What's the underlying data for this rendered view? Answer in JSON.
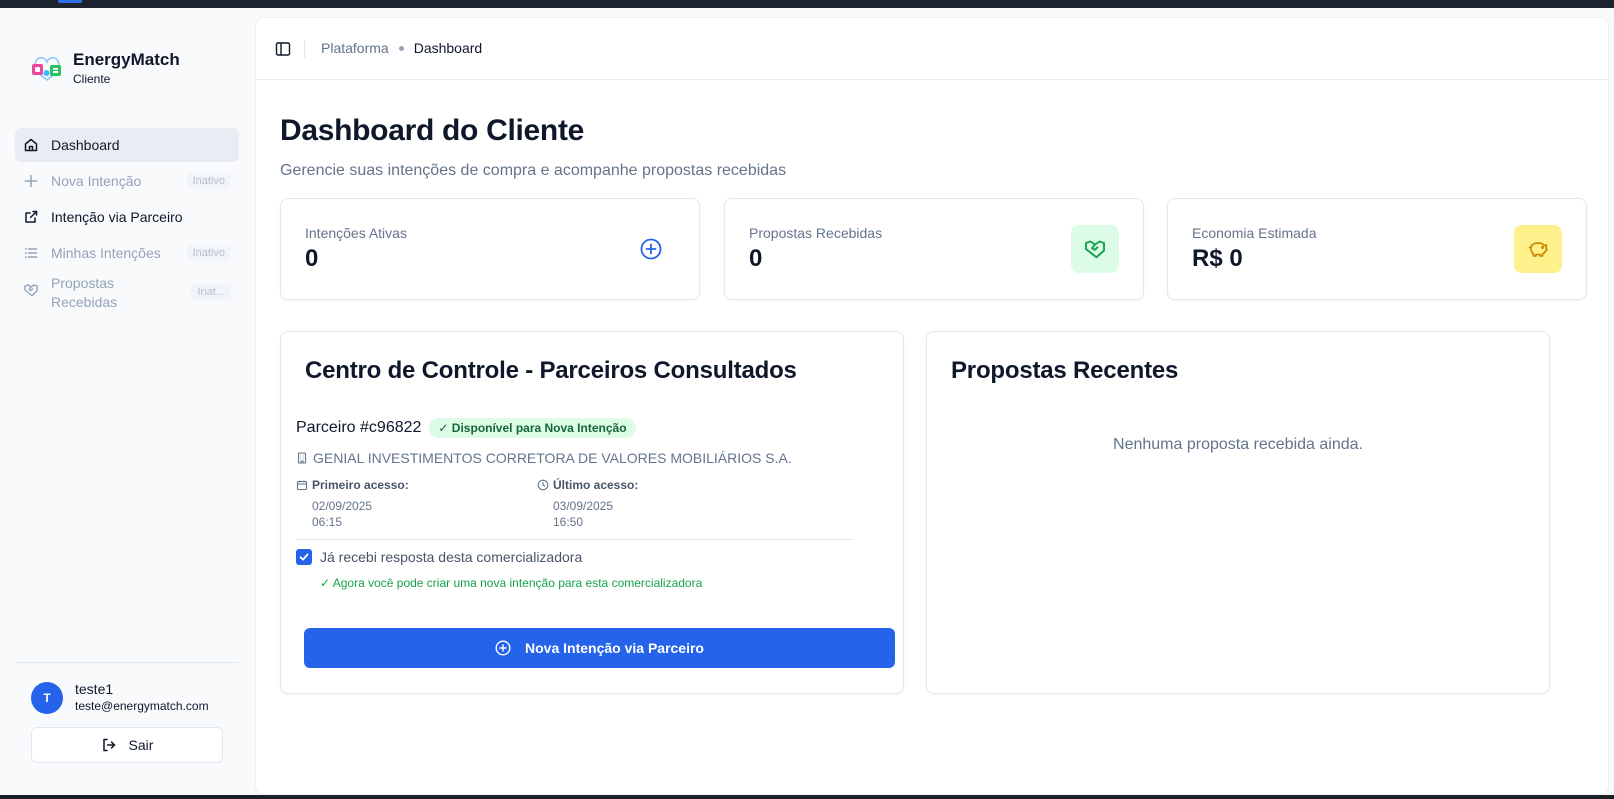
{
  "brand": {
    "title": "EnergyMatch",
    "subtitle": "Cliente"
  },
  "nav": [
    {
      "label": "Dashboard",
      "icon": "home-icon",
      "active": true
    },
    {
      "label": "Nova Intenção",
      "icon": "plus-icon",
      "badge": "Inativo",
      "disabled": true
    },
    {
      "label": "Intenção via Parceiro",
      "icon": "external-link-icon"
    },
    {
      "label": "Minhas Intenções",
      "icon": "list-icon",
      "badge": "Inativo",
      "disabled": true
    },
    {
      "label": "Propostas Recebidas",
      "icon": "handshake-icon",
      "badge": "Inat...",
      "disabled": true
    }
  ],
  "user": {
    "initial": "T",
    "name": "teste1",
    "email": "teste@energymatch.com",
    "logout_label": "Sair"
  },
  "breadcrumb": {
    "parent": "Plataforma",
    "current": "Dashboard"
  },
  "page": {
    "title": "Dashboard do Cliente",
    "subtitle": "Gerencie suas intenções de compra e acompanhe propostas recebidas"
  },
  "stats": [
    {
      "label": "Intenções Ativas",
      "value": "0",
      "icon": "plus-circle-icon",
      "color": "#2563eb"
    },
    {
      "label": "Propostas Recebidas",
      "value": "0",
      "icon": "handshake-icon",
      "color": "#16a34a"
    },
    {
      "label": "Economia Estimada",
      "value": "R$ 0",
      "icon": "piggy-bank-icon",
      "color": "#ca8a04"
    }
  ],
  "control_center": {
    "title": "Centro de Controle - Parceiros Consultados",
    "partner": {
      "name": "Parceiro #c96822",
      "status_badge": "✓ Disponível para Nova Intenção",
      "company": "GENIAL INVESTIMENTOS CORRETORA DE VALORES MOBILIÁRIOS S.A.",
      "first_access_label": "Primeiro acesso:",
      "first_access_date": "02/09/2025",
      "first_access_time": "06:15",
      "last_access_label": "Último acesso:",
      "last_access_date": "03/09/2025",
      "last_access_time": "16:50",
      "checkbox_label": "Já recebi resposta desta comercializadora",
      "checkbox_checked": true,
      "ok_note": "✓ Agora você pode criar uma nova intenção para esta comercializadora"
    },
    "cta_label": "Nova Intenção via Parceiro"
  },
  "recent_proposals": {
    "title": "Propostas Recentes",
    "empty_message": "Nenhuma proposta recebida ainda."
  },
  "colors": {
    "primary": "#2563eb",
    "success": "#16a34a",
    "warning": "#ca8a04",
    "muted": "#64748b"
  }
}
